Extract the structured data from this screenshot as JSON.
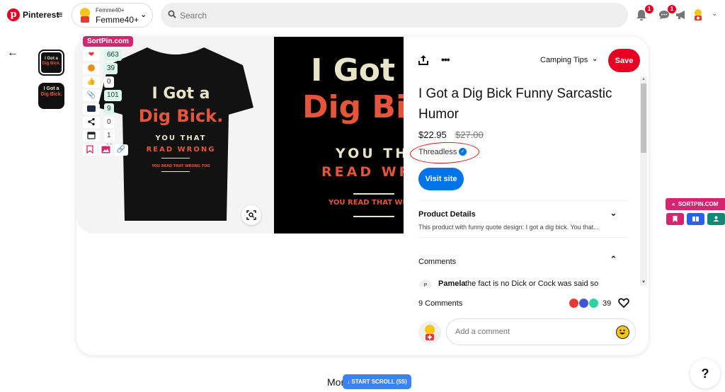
{
  "header": {
    "brand": "Pinterest",
    "account": {
      "handle": "Femme40+",
      "name": "Femme40+"
    },
    "search": {
      "placeholder": "Search",
      "value": ""
    },
    "notifications_badge": "1",
    "messages_badge": "1"
  },
  "thumbnails": [
    {
      "label": "pin-image-1",
      "active": true
    },
    {
      "label": "pin-image-2",
      "active": false
    }
  ],
  "shirt_print": {
    "line1": "I Got a",
    "line2": "Dig Bick.",
    "line3": "YOU THAT",
    "line4": "READ WRONG",
    "line5": "YOU READ THAT WRONG TOO"
  },
  "sortpin": {
    "label": "SortPin.com",
    "stats": [
      {
        "icon": "heart-icon",
        "value": "663",
        "highlight": true
      },
      {
        "icon": "smiley-icon",
        "value": "39",
        "highlight": true
      },
      {
        "icon": "thumbs-up-icon",
        "value": "0",
        "highlight": false
      },
      {
        "icon": "paperclip-icon",
        "value": "101",
        "highlight": true
      },
      {
        "icon": "comment-icon",
        "value": "9",
        "highlight": true
      },
      {
        "icon": "share-icon",
        "value": "0",
        "highlight": false
      },
      {
        "icon": "calendar-icon",
        "value": "1 Y",
        "highlight": false
      }
    ],
    "side_label": "SORTPIN.COM",
    "colors": {
      "pink": "#d6246e",
      "blue": "#2563eb",
      "teal": "#0f8a74"
    }
  },
  "pin": {
    "board": "Camping Tips",
    "save_label": "Save",
    "title": "I Got a Dig Bick Funny Sarcastic Humor",
    "price": "$22.95",
    "price_original": "$27.00",
    "merchant": "Threadless",
    "visit_label": "Visit site",
    "product_details_title": "Product Details",
    "product_details_desc": "This product with funny quote design: I got a dig bick. You that...",
    "comments_title": "Comments",
    "first_comment": {
      "avatar_initial": "P",
      "author": "Pamela",
      "text": "the fact is no Dick or Cock was said so"
    },
    "comments_count": "9 Comments",
    "reactions_count": "39",
    "comment_placeholder": "Add a comment"
  },
  "footer": {
    "more_text": "More",
    "scroll_button": "↓ START SCROLL (5S)",
    "help": "?"
  },
  "colors": {
    "pinterest_red": "#e60023",
    "visit_blue": "#0074e8",
    "annotation_red": "#dd1111"
  }
}
